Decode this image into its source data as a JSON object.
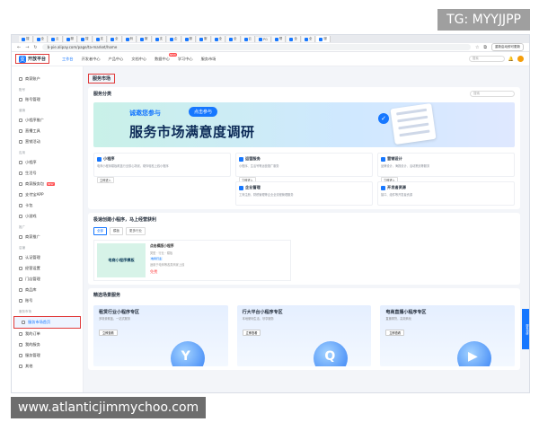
{
  "browser": {
    "tabs": [
      "搜",
      "全",
      "云",
      "服",
      "搜",
      "支",
      "全",
      "蚂",
      "服",
      "支",
      "企",
      "服",
      "服",
      "全",
      "全",
      "云",
      "PG",
      "帮",
      "全",
      "全",
      "服"
    ],
    "url": "b-pie.alipay.com/page/ta-market/home",
    "update_btn": "重新启动即可更新"
  },
  "header": {
    "logo_text": "开放平台",
    "nav": [
      {
        "label": "工作台",
        "active": true
      },
      {
        "label": "开发者中心",
        "active": false
      },
      {
        "label": "产品中心",
        "active": false
      },
      {
        "label": "文档中心",
        "active": false
      },
      {
        "label": "数据中心",
        "active": false,
        "badge": "NEW"
      },
      {
        "label": "学习中心",
        "active": false
      },
      {
        "label": "服务市场",
        "active": false
      }
    ],
    "search_placeholder": "搜索"
  },
  "sidebar": {
    "items": [
      {
        "group": "",
        "label": "商家账户"
      },
      {
        "group": "账号",
        "label": "账号管理"
      },
      {
        "group": "营销",
        "label": "小程序推广"
      },
      {
        "group": "",
        "label": "直播工具"
      },
      {
        "group": "",
        "label": "营销活动"
      },
      {
        "group": "应用",
        "label": "小程序"
      },
      {
        "group": "",
        "label": "生活号"
      },
      {
        "group": "",
        "label": "商家服务包",
        "badge": "NEW"
      },
      {
        "group": "",
        "label": "支付宝APP"
      },
      {
        "group": "",
        "label": "卡包"
      },
      {
        "group": "",
        "label": "小游戏"
      },
      {
        "group": "推广",
        "label": "商家推广"
      },
      {
        "group": "店铺",
        "label": "认证管理"
      },
      {
        "group": "",
        "label": "经营设置"
      },
      {
        "group": "",
        "label": "门店管理"
      },
      {
        "group": "",
        "label": "商品库"
      },
      {
        "group": "",
        "label": "账号"
      },
      {
        "group": "服务市场",
        "label": "服务市场首页",
        "selected": true
      },
      {
        "group": "",
        "label": "我的订单"
      },
      {
        "group": "",
        "label": "我的服务"
      },
      {
        "group": "",
        "label": "服务管理"
      },
      {
        "group": "",
        "label": "其他"
      }
    ]
  },
  "main": {
    "breadcrumb": "服务市场",
    "category_title": "服务分类",
    "category_search_placeholder": "搜索",
    "banner": {
      "tag": "诚邀您参与",
      "button": "点击参与",
      "headline": "服务市场满意度调研"
    },
    "services": [
      {
        "name": "小程序",
        "desc": "电商小程序模板覆盖行业核心场景，助你轻松上线小程序",
        "link": "立即进入"
      },
      {
        "name": "运营服务",
        "desc": "小程序、生活号等运营推广服务",
        "link": "立即进入"
      },
      {
        "name": "营销设计",
        "desc": "品牌设计、海报设计、活动策划等服务",
        "link": "立即进入"
      },
      {
        "name": "",
        "desc": "",
        "link": ""
      },
      {
        "name": "企业管理",
        "desc": "工商注册、财税管理等企业全流程管理服务",
        "link": ""
      },
      {
        "name": "开发者资源",
        "desc": "接口、组件等开发者资源",
        "link": ""
      }
    ],
    "quick_title": "极速创建小程序，马上经营获利",
    "filters": [
      "全部",
      "模板",
      "更多行业"
    ],
    "product": {
      "thumb": "电商小程序模板",
      "title": "点击模版小程序",
      "meta": "类型 · 行业 · 模板",
      "tag": "电商行业",
      "desc": "适用于电商等各类商家上线",
      "price": "免费"
    },
    "featured_title": "精选场景服务",
    "zones": [
      {
        "title": "租赁行业小程序专区",
        "sub": "多场景覆盖，一站式服务",
        "btn": "立即查看",
        "glyph": "Y"
      },
      {
        "title": "行大平台小程序专区",
        "sub": "本地便利生活，尽享服务",
        "btn": "立即查看",
        "glyph": "Q"
      },
      {
        "title": "电商直播小程序专区",
        "sub": "直播带货，高效转化",
        "btn": "立即查看",
        "glyph": "▶"
      }
    ],
    "float_tab": "服务调研"
  },
  "watermarks": {
    "top": "TG: MYYJJPP",
    "bottom": "www.atlanticjimmychoo.com"
  }
}
